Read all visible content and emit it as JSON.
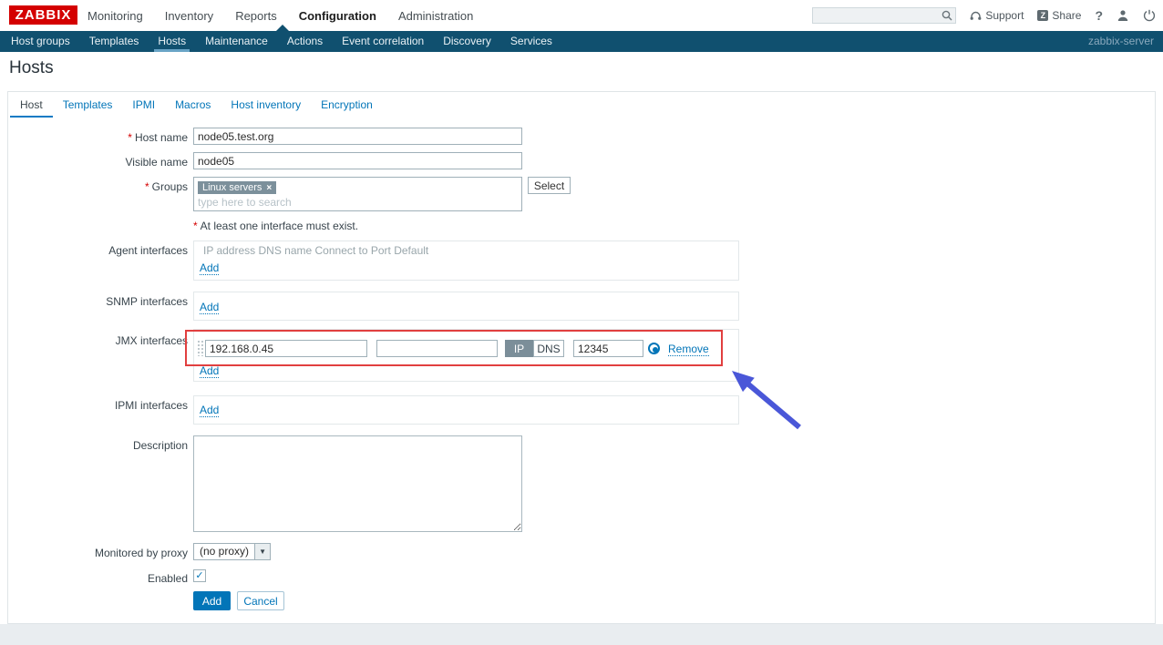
{
  "colors": {
    "brand_red": "#d40000",
    "link_blue": "#0275b8",
    "nav_bg": "#10506f",
    "nav_active_underline": "#69a4c6",
    "chip_gray": "#7c909b",
    "toggle_active_gray": "#7b8e99",
    "annotation_red": "#e13f3f",
    "annotation_arrow_blue": "#4a57d8",
    "primary_button_blue": "#0275b8"
  },
  "topnav": {
    "logo": "ZABBIX",
    "items": [
      "Monitoring",
      "Inventory",
      "Reports",
      "Configuration",
      "Administration"
    ],
    "active_item": "Configuration",
    "search": {
      "value": ""
    },
    "support_label": "Support",
    "share_badge": "Z",
    "share_label": "Share",
    "help_label": "?"
  },
  "subnav": {
    "items": [
      "Host groups",
      "Templates",
      "Hosts",
      "Maintenance",
      "Actions",
      "Event correlation",
      "Discovery",
      "Services"
    ],
    "active_item": "Hosts",
    "server_name": "zabbix-server"
  },
  "page": {
    "title": "Hosts"
  },
  "tabs": {
    "items": [
      "Host",
      "Templates",
      "IPMI",
      "Macros",
      "Host inventory",
      "Encryption"
    ],
    "active": "Host"
  },
  "form": {
    "host_name": {
      "required_mark": "*",
      "label": "Host name",
      "value": "node05.test.org"
    },
    "visible_name": {
      "label": "Visible name",
      "value": "node05"
    },
    "groups": {
      "required_mark": "*",
      "label": "Groups",
      "chip_label": "Linux servers",
      "chip_remove": "×",
      "placeholder": "type here to search",
      "select_button": "Select"
    },
    "interface_note": {
      "required_mark": "*",
      "text": "At least one interface must exist."
    },
    "agent_interfaces": {
      "label": "Agent interfaces",
      "columns_header": "IP address DNS name Connect to Port Default",
      "add_link": "Add"
    },
    "snmp_interfaces": {
      "label": "SNMP interfaces",
      "add_link": "Add"
    },
    "jmx_interfaces": {
      "label": "JMX interfaces",
      "add_link": "Add",
      "row": {
        "ip_value": "192.168.0.45",
        "dns_value": "",
        "ip_toggle": "IP",
        "dns_toggle": "DNS",
        "port_value": "12345",
        "default_selected": true,
        "remove_link": "Remove"
      }
    },
    "ipmi_interfaces": {
      "label": "IPMI interfaces",
      "add_link": "Add"
    },
    "description": {
      "label": "Description",
      "value": ""
    },
    "proxy": {
      "label": "Monitored by proxy",
      "value": "(no proxy)",
      "dropdown_glyph": "▼"
    },
    "enabled": {
      "label": "Enabled",
      "checked": true
    },
    "actions": {
      "add_button": "Add",
      "cancel_button": "Cancel"
    }
  }
}
